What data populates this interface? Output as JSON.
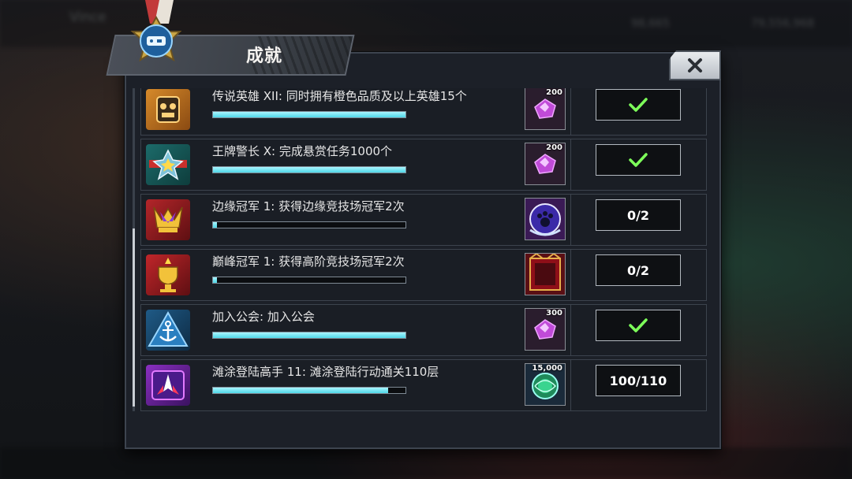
{
  "window": {
    "title": "成就",
    "close_icon": "close-icon"
  },
  "background": {
    "player_name": "Vince",
    "resource_1": "98,665",
    "resource_2": "79,556,968"
  },
  "achievements": [
    {
      "icon": "legend-hero-icon",
      "description": "传说英雄 XII: 同时拥有橙色品质及以上英雄15个",
      "progress_fraction": 1.0,
      "reward_icon": "gem-icon",
      "reward_qty": "200",
      "status": "completed",
      "status_label": ""
    },
    {
      "icon": "sheriff-badge-icon",
      "description": "王牌警长 X: 完成悬赏任务1000个",
      "progress_fraction": 1.0,
      "reward_icon": "gem-icon",
      "reward_qty": "200",
      "status": "completed",
      "status_label": ""
    },
    {
      "icon": "edge-champion-icon",
      "description": "边缘冠军 1: 获得边缘竞技场冠军2次",
      "progress_fraction": 0.0,
      "reward_icon": "paw-avatar-frame-icon",
      "reward_qty": "",
      "status": "in_progress",
      "status_label": "0/2"
    },
    {
      "icon": "peak-champion-icon",
      "description": "巅峰冠军 1: 获得高阶竞技场冠军2次",
      "progress_fraction": 0.0,
      "reward_icon": "red-avatar-frame-icon",
      "reward_qty": "",
      "status": "in_progress",
      "status_label": "0/2"
    },
    {
      "icon": "guild-anchor-icon",
      "description": "加入公会: 加入公会",
      "progress_fraction": 1.0,
      "reward_icon": "gem-icon",
      "reward_qty": "300",
      "status": "completed",
      "status_label": ""
    },
    {
      "icon": "beach-landing-icon",
      "description": "滩涂登陆高手 11: 滩涂登陆行动通关110层",
      "progress_fraction": 0.909,
      "reward_icon": "green-orb-icon",
      "reward_qty": "15,000",
      "status": "in_progress",
      "status_label": "100/110"
    }
  ],
  "colors": {
    "accent_cyan": "#6fe3f0",
    "check_green": "#7dff5a",
    "gem_purple": "#c04bd8"
  }
}
